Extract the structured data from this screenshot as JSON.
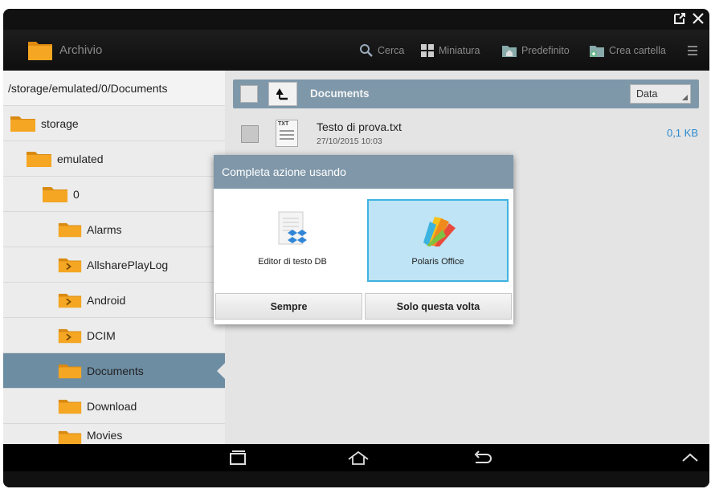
{
  "app": {
    "title": "Archivio"
  },
  "actions": {
    "search": "Cerca",
    "thumbnail": "Miniatura",
    "default": "Predefinito",
    "new_folder": "Crea cartella"
  },
  "sidebar": {
    "path": "/storage/emulated/0/Documents",
    "items": [
      {
        "label": "storage"
      },
      {
        "label": "emulated"
      },
      {
        "label": "0"
      },
      {
        "label": "Alarms"
      },
      {
        "label": "AllsharePlayLog"
      },
      {
        "label": "Android"
      },
      {
        "label": "DCIM"
      },
      {
        "label": "Documents"
      },
      {
        "label": "Download"
      },
      {
        "label": "Movies"
      }
    ]
  },
  "main": {
    "current_folder": "Documents",
    "sort": "Data",
    "files": [
      {
        "name": "Testo di prova.txt",
        "date": "27/10/2015 10:03",
        "size": "0,1 KB",
        "type_badge": "TXT"
      }
    ]
  },
  "dialog": {
    "title": "Completa azione usando",
    "apps": [
      {
        "label": "Editor di testo DB",
        "icon": "dropbox-text-editor-icon"
      },
      {
        "label": "Polaris Office",
        "icon": "polaris-office-icon",
        "selected": true
      }
    ],
    "always": "Sempre",
    "just_once": "Solo questa volta"
  },
  "colors": {
    "accent": "#3fb2e0",
    "header_blue": "#7f97a9",
    "selected_row": "#6d8da3",
    "link": "#2a8ad0",
    "folder": "#f2a21a"
  }
}
